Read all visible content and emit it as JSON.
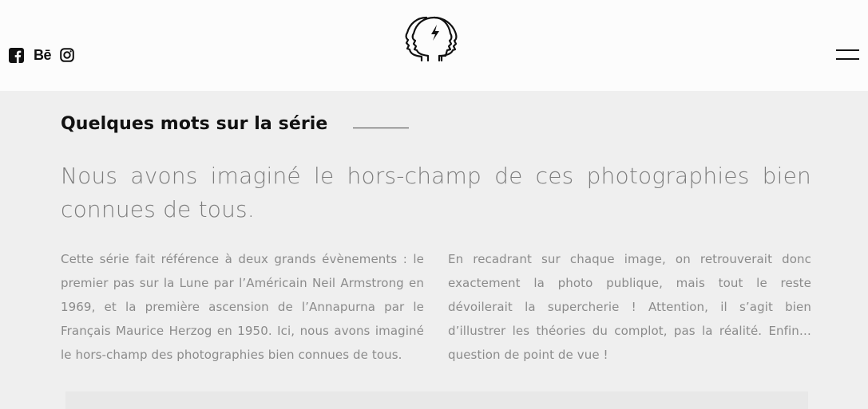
{
  "header": {
    "social": [
      {
        "name": "Facebook",
        "icon": "facebook-icon"
      },
      {
        "name": "Behance",
        "icon": "behance-icon",
        "glyph": "Bē"
      },
      {
        "name": "Instagram",
        "icon": "instagram-icon"
      }
    ],
    "logo": {
      "icon": "two-heads-lightning-logo"
    },
    "menu": {
      "icon": "hamburger-menu-icon"
    }
  },
  "content": {
    "section_title": "Quelques mots sur la série",
    "lead": "Nous avons imaginé le hors-champ de ces photographies bien connues de tous.",
    "paragraph_left": "Cette série fait référence à deux grands évènements : le premier pas sur la Lune par l’Américain Neil Armstrong en 1969, et la première ascension de l’Annapurna par le Français Maurice Herzog en 1950. Ici, nous avons imaginé le hors-champ des photographies bien connues de tous.",
    "paragraph_right": "En recadrant sur chaque image, on retrouverait donc exactement la photo publique, mais tout le reste dévoilerait la supercherie ! Attention, il s’agit bien d’illustrer les théories du complot, pas la réalité. Enfin… question de point de vue !"
  },
  "colors": {
    "header_bg": "#fcfcfc",
    "page_bg": "#efefef",
    "title": "#111111",
    "lead_text": "#7d7d7d",
    "body_text": "#8b8b8b"
  }
}
